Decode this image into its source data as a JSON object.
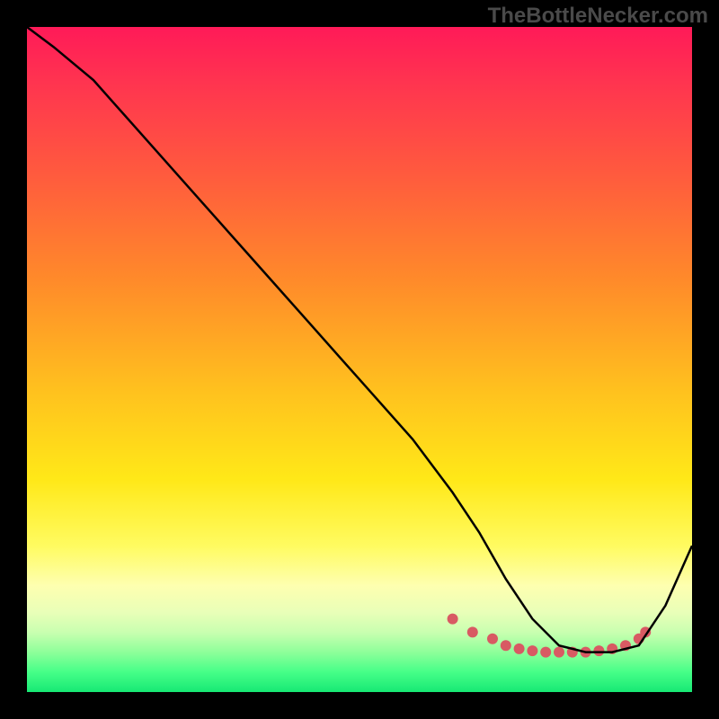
{
  "watermark": "TheBottleNecker.com",
  "chart_data": {
    "type": "line",
    "title": "",
    "xlabel": "",
    "ylabel": "",
    "xlim": [
      0,
      100
    ],
    "ylim": [
      0,
      100
    ],
    "grid": false,
    "series": [
      {
        "name": "curve",
        "color": "#000000",
        "x": [
          0,
          4,
          10,
          18,
          26,
          34,
          42,
          50,
          58,
          64,
          68,
          72,
          76,
          80,
          84,
          88,
          92,
          96,
          100
        ],
        "y": [
          100,
          97,
          92,
          83,
          74,
          65,
          56,
          47,
          38,
          30,
          24,
          17,
          11,
          7,
          6,
          6,
          7,
          13,
          22
        ]
      }
    ],
    "marker_points": {
      "name": "highlight-dots",
      "color": "#d85a63",
      "x": [
        64,
        67,
        70,
        72,
        74,
        76,
        78,
        80,
        82,
        84,
        86,
        88,
        90,
        92,
        93
      ],
      "y": [
        11,
        9,
        8,
        7,
        6.5,
        6.2,
        6,
        6,
        6,
        6,
        6.2,
        6.5,
        7,
        8,
        9
      ]
    },
    "background_gradient": {
      "stops": [
        {
          "pos": 0.0,
          "color": "#ff1a58"
        },
        {
          "pos": 0.22,
          "color": "#ff5a3e"
        },
        {
          "pos": 0.55,
          "color": "#ffc21e"
        },
        {
          "pos": 0.78,
          "color": "#fffb60"
        },
        {
          "pos": 0.94,
          "color": "#8eff9a"
        },
        {
          "pos": 1.0,
          "color": "#17e874"
        }
      ]
    }
  }
}
